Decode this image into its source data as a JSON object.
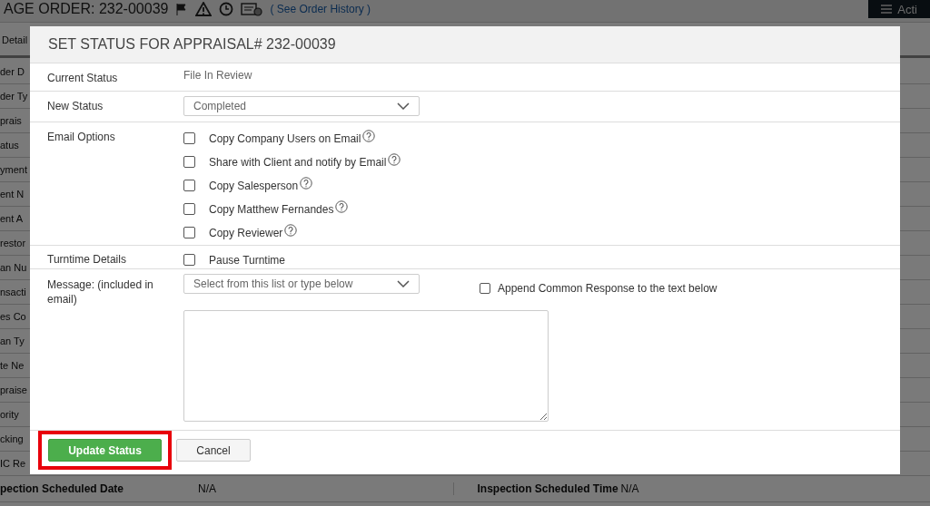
{
  "page": {
    "title": "AGE ORDER: 232-00039",
    "history_link": "( See Order History )",
    "actions_button": "Acti",
    "tab": "Detail",
    "rows": [
      {
        "label": "der D"
      },
      {
        "label": "der Ty"
      },
      {
        "label": "prais"
      },
      {
        "label": "atus"
      },
      {
        "label": "yment"
      },
      {
        "label": "ent N"
      },
      {
        "label": "ent A"
      },
      {
        "label": "restor"
      },
      {
        "label": "an Nu"
      },
      {
        "label": "nsacti"
      },
      {
        "label": "es Co"
      },
      {
        "label": "an Ty"
      },
      {
        "label": "te Ne"
      },
      {
        "label": "praise"
      },
      {
        "label": "ority"
      },
      {
        "label": "cking"
      },
      {
        "label": "IC Re"
      }
    ],
    "bottom_row": [
      {
        "label": "pection Scheduled Date",
        "value": "N/A"
      },
      {
        "label": "Inspection Scheduled Time",
        "value": "N/A"
      }
    ]
  },
  "dialog": {
    "title": "SET STATUS FOR APPRAISAL# 232-00039",
    "current_status": {
      "label": "Current Status",
      "value": "File In Review"
    },
    "new_status": {
      "label": "New Status",
      "value": "Completed"
    },
    "email_options": {
      "label": "Email Options",
      "options": [
        {
          "label": "Copy Company Users on Email",
          "checked": false
        },
        {
          "label": "Share with Client and notify by Email",
          "checked": false
        },
        {
          "label": "Copy Salesperson",
          "checked": false
        },
        {
          "label": "Copy Matthew Fernandes",
          "checked": false
        },
        {
          "label": "Copy Reviewer",
          "checked": false
        }
      ]
    },
    "turntime": {
      "label": "Turntime Details",
      "option": {
        "label": "Pause Turntime",
        "checked": false
      }
    },
    "message": {
      "label": "Message: (included in email)",
      "placeholder": "Select from this list or type below",
      "append": {
        "label": "Append Common Response to the text below",
        "checked": false
      }
    },
    "buttons": [
      {
        "label": "Update Status",
        "kind": "primary",
        "highlighted": true
      },
      {
        "label": "Cancel",
        "kind": "secondary",
        "highlighted": false
      }
    ]
  }
}
